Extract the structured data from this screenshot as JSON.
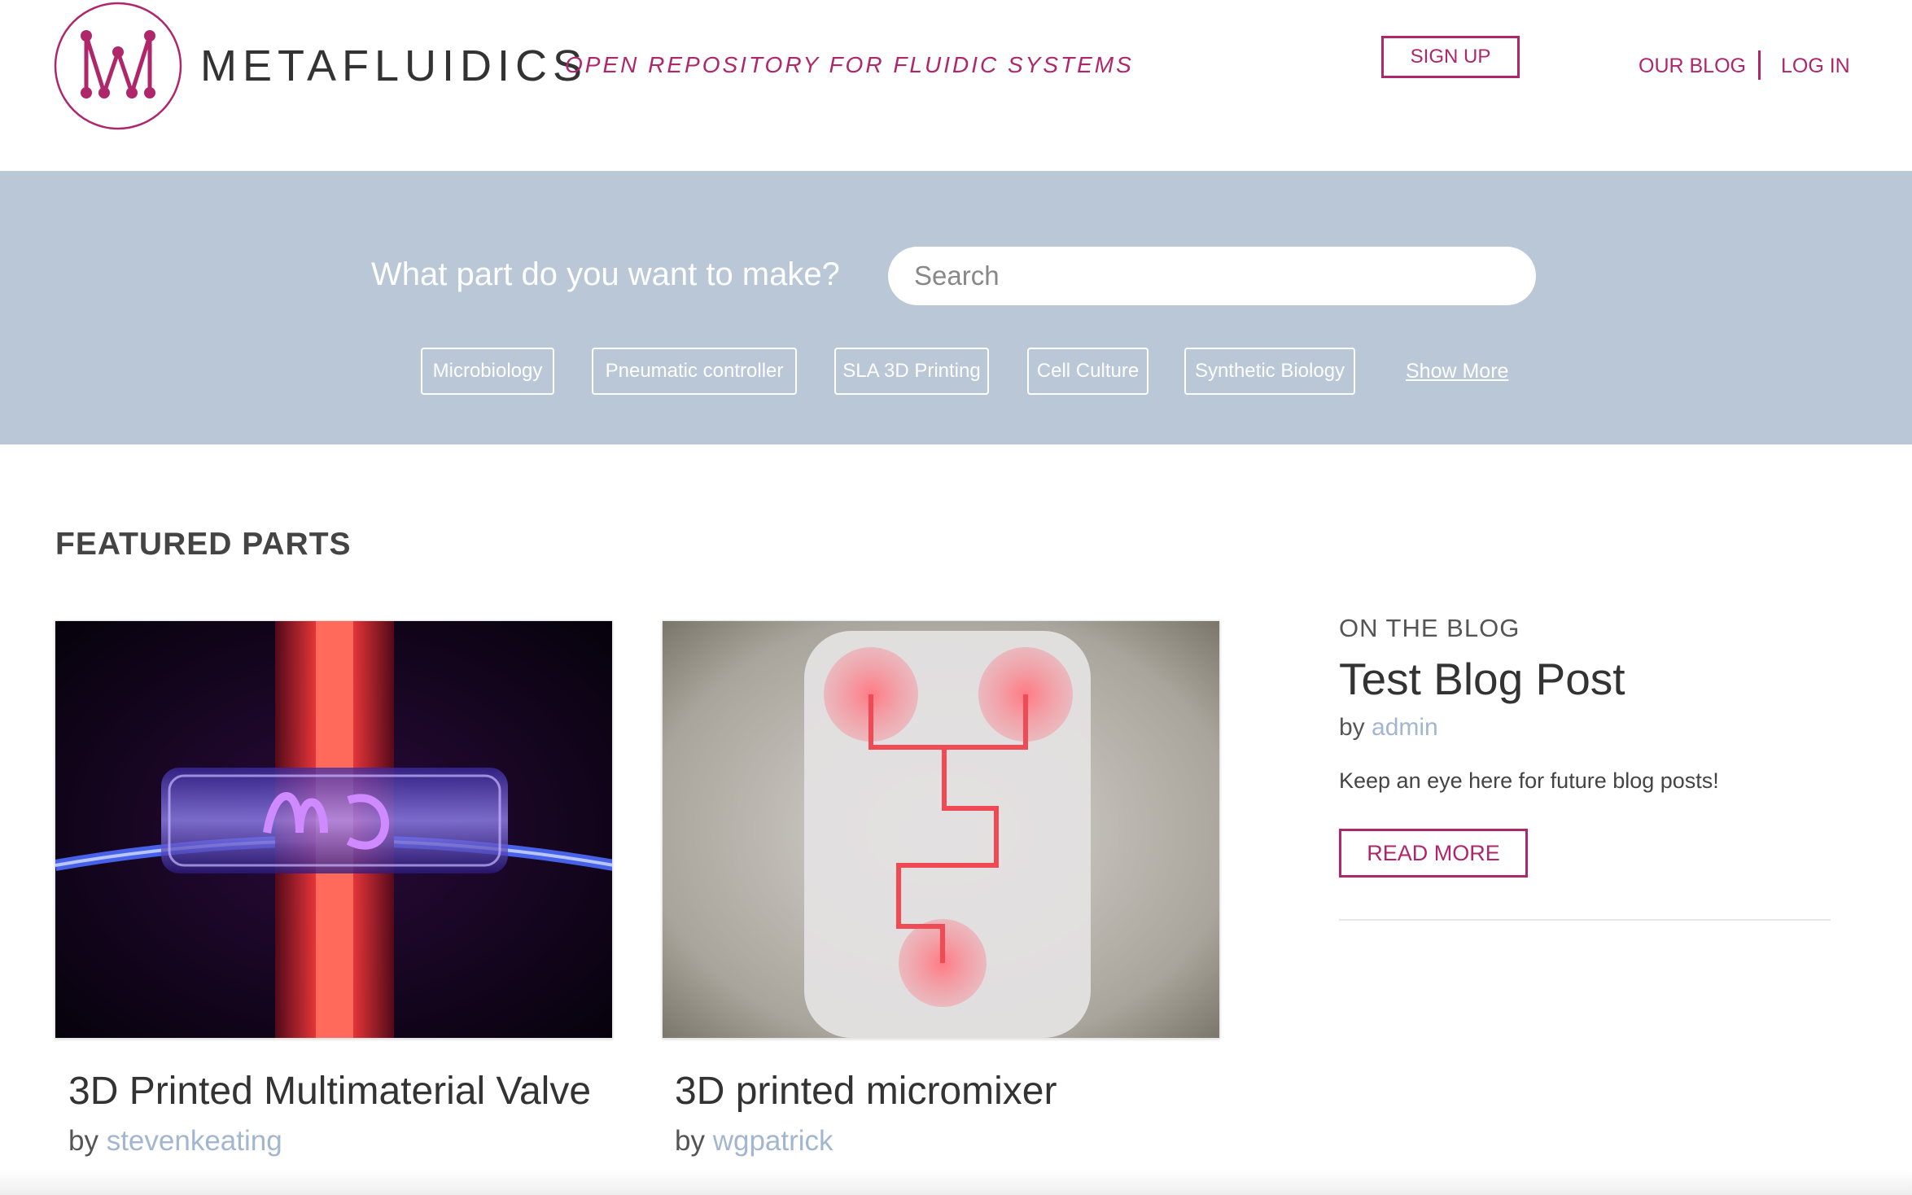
{
  "brand": {
    "logo_letter": "M",
    "name": "METAFLUIDICS",
    "tagline": "OPEN REPOSITORY FOR FLUIDIC SYSTEMS",
    "accent_color": "#b0266a"
  },
  "header": {
    "signup_label": "SIGN UP",
    "nav": {
      "blog_label": "OUR BLOG",
      "login_label": "LOG IN"
    }
  },
  "search": {
    "prompt": "What part do you want to make?",
    "placeholder": "Search",
    "value": "",
    "band_color": "#b9c7d7",
    "tags": [
      "Microbiology",
      "Pneumatic controller",
      "SLA 3D Printing",
      "Cell Culture",
      "Synthetic Biology"
    ],
    "show_more_label": "Show More"
  },
  "featured": {
    "heading": "FEATURED PARTS",
    "parts": [
      {
        "title": "3D Printed Multimaterial Valve",
        "by_label": "by",
        "author": "stevenkeating",
        "image": "multimaterial-valve-photo"
      },
      {
        "title": "3D printed micromixer",
        "by_label": "by",
        "author": "wgpatrick",
        "image": "micromixer-photo"
      }
    ]
  },
  "blog": {
    "kicker": "ON THE BLOG",
    "title": "Test Blog Post",
    "by_label": "by",
    "author": "admin",
    "excerpt": "Keep an eye here for future blog posts!",
    "read_more_label": "READ MORE"
  }
}
